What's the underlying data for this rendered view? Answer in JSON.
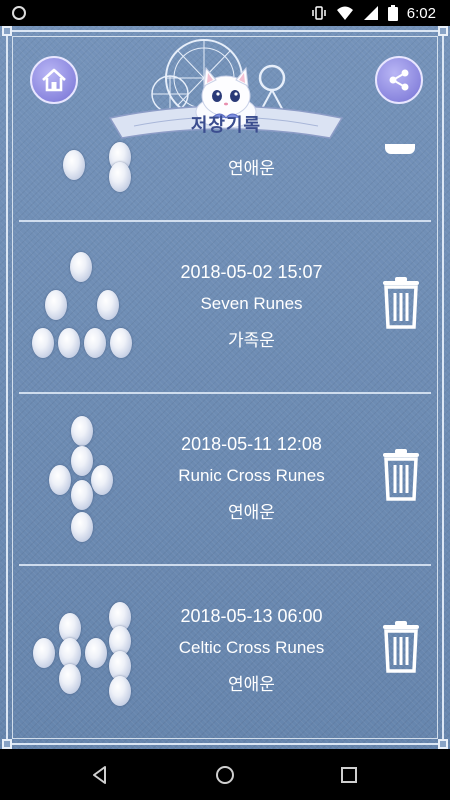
{
  "status_bar": {
    "time": "6:02",
    "icons": [
      "sync-icon",
      "vibrate-icon",
      "wifi-icon",
      "signal-icon",
      "battery-icon"
    ]
  },
  "header": {
    "title": "저장기록",
    "home_icon": "home-icon",
    "share_icon": "share-icon"
  },
  "records": [
    {
      "date": "",
      "title": "",
      "fortune": "연애운",
      "spread": "partial",
      "partial": true
    },
    {
      "date": "2018-05-02 15:07",
      "title": "Seven Runes",
      "fortune": "가족운",
      "spread": "seven"
    },
    {
      "date": "2018-05-11 12:08",
      "title": "Runic Cross Runes",
      "fortune": "연애운",
      "spread": "cross"
    },
    {
      "date": "2018-05-13 06:00",
      "title": "Celtic Cross Runes",
      "fortune": "연애운",
      "spread": "celtic"
    }
  ],
  "colors": {
    "background": "#6f8fb5",
    "text": "#ffffff",
    "button": "#8a86de"
  },
  "nav": {
    "icons": [
      "back-icon",
      "home-nav-icon",
      "recents-icon"
    ]
  }
}
